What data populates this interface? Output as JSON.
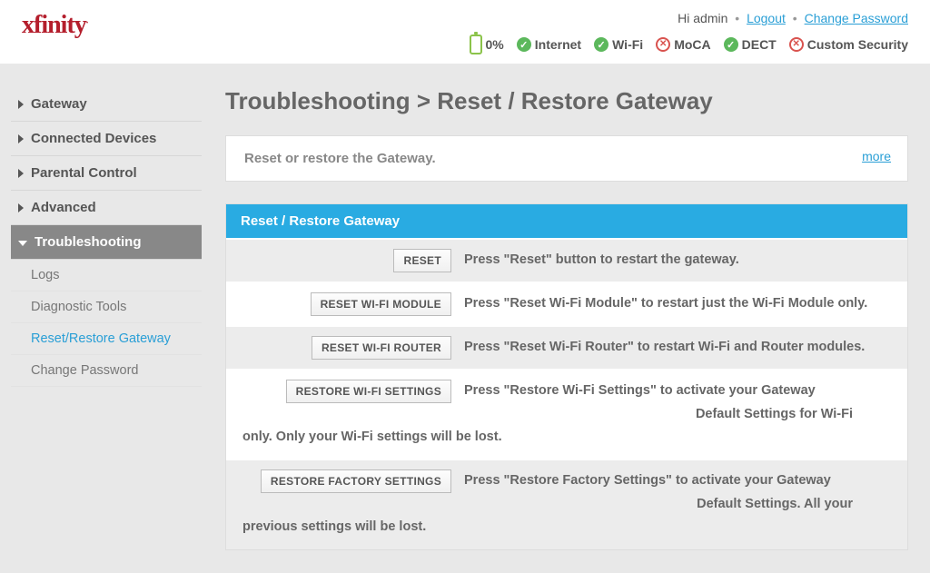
{
  "header": {
    "logo_text": "xfinity",
    "greeting": "Hi admin",
    "logout": "Logout",
    "change_password": "Change Password",
    "battery_pct": "0%",
    "status": {
      "internet": "Internet",
      "wifi": "Wi-Fi",
      "moca": "MoCA",
      "dect": "DECT",
      "custom_security": "Custom Security"
    }
  },
  "sidebar": {
    "items": [
      "Gateway",
      "Connected Devices",
      "Parental Control",
      "Advanced",
      "Troubleshooting"
    ],
    "sub": [
      "Logs",
      "Diagnostic Tools",
      "Reset/Restore Gateway",
      "Change Password"
    ]
  },
  "page": {
    "title": "Troubleshooting > Reset / Restore Gateway",
    "intro": "Reset or restore the Gateway.",
    "more": "more",
    "section_header": "Reset / Restore Gateway",
    "rows": [
      {
        "button": "RESET",
        "desc": "Press \"Reset\" button to restart the gateway."
      },
      {
        "button": "RESET WI-FI MODULE",
        "desc": "Press \"Reset Wi-Fi Module\" to restart just the Wi-Fi Module only."
      },
      {
        "button": "RESET WI-FI ROUTER",
        "desc": "Press \"Reset Wi-Fi Router\" to restart Wi-Fi and Router modules."
      },
      {
        "button": "RESTORE WI-FI SETTINGS",
        "desc_top": "Press \"Restore Wi-Fi Settings\" to activate your Gateway",
        "desc_cont": "Default Settings for Wi-Fi only. Only your Wi-Fi settings will be lost."
      },
      {
        "button": "RESTORE FACTORY SETTINGS",
        "desc_top": "Press \"Restore Factory Settings\" to activate your Gateway",
        "desc_cont": "Default Settings. All your previous settings will be lost."
      }
    ]
  }
}
